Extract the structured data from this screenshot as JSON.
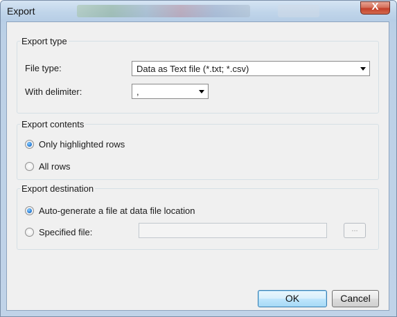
{
  "window": {
    "title": "Export",
    "close_glyph": "X"
  },
  "export_type": {
    "legend": "Export type",
    "file_type_label": "File type:",
    "file_type_value": "Data as Text file (*.txt; *.csv)",
    "delimiter_label": "With delimiter:",
    "delimiter_value": ","
  },
  "export_contents": {
    "legend": "Export contents",
    "options": [
      {
        "label": "Only highlighted rows",
        "checked": true
      },
      {
        "label": "All rows",
        "checked": false
      }
    ]
  },
  "export_destination": {
    "legend": "Export destination",
    "options": [
      {
        "label": "Auto-generate a file at data file location",
        "checked": true
      },
      {
        "label": "Specified file:",
        "checked": false
      }
    ],
    "specified_file_value": "",
    "browse_label": "..."
  },
  "buttons": {
    "ok_label": "OK",
    "cancel_label": "Cancel"
  },
  "colors": {
    "title_bar": "#c0d5ea",
    "close_button": "#c3402a",
    "dialog_background": "#f0f0f0",
    "default_button_border": "#3c7fb1"
  },
  "icons": {
    "close": "close-icon",
    "dropdown": "chevron-down-icon"
  }
}
